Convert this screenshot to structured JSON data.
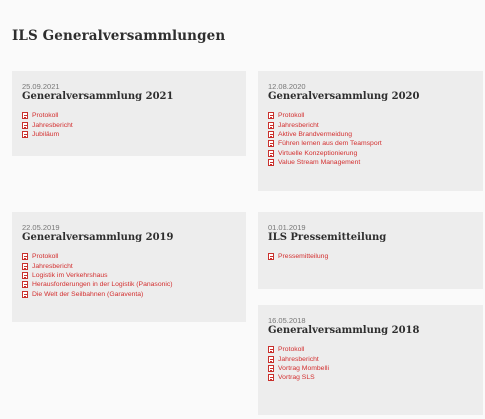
{
  "page": {
    "title": "ILS Generalversammlungen"
  },
  "cards": [
    {
      "date": "25.09.2021",
      "title": "Generalversammlung 2021",
      "links": [
        "Protokoll",
        "Jahresbericht",
        "Jubiläum"
      ]
    },
    {
      "date": "12.08.2020",
      "title": "Generalversammlung 2020",
      "links": [
        "Protokoll",
        "Jahresbericht",
        "Aktive Brandvermeidung",
        "Führen lernen aus dem Teamsport",
        "Virtuelle Konzeptionierung",
        "Value Stream Management"
      ]
    },
    {
      "date": "22.05.2019",
      "title": "Generalversammlung 2019",
      "links": [
        "Protokoll",
        "Jahresbericht",
        "Logistik im Verkehrshaus",
        "Herausforderungen in der Logistik (Panasonic)",
        "Die Welt der Seilbahnen (Garaventa)"
      ]
    },
    {
      "date": "01.01.2019",
      "title": "ILS Pressemitteilung",
      "links": [
        "Pressemitteilung"
      ]
    },
    {
      "date": "16.05.2018",
      "title": "Generalversammlung 2018",
      "links": [
        "Protokoll",
        "Jahresbericht",
        "Vortrag Mombelli",
        "Vortrag SLS"
      ]
    }
  ],
  "colors": {
    "background": "#fafafa",
    "card": "#ededed",
    "link": "#d32f2f",
    "pdf_icon": "#c9302c",
    "title": "#2e2e2e",
    "date": "#777777"
  },
  "icons": {
    "document": "pdf-icon"
  }
}
